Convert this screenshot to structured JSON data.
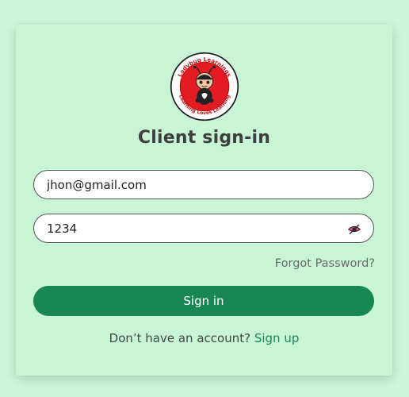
{
  "logo": {
    "top_text": "Ladybug Learnings",
    "bottom_text": "Learning Loves Learning"
  },
  "title": "Client sign-in",
  "form": {
    "email_value": "jhon@gmail.com",
    "password_value": "1234",
    "password_toggle_icon": "eye-slash-icon"
  },
  "forgot_password_label": "Forgot Password?",
  "signin_label": "Sign in",
  "signup": {
    "prompt": "Don’t have an account?",
    "link_label": "Sign up"
  },
  "colors": {
    "page_background": "#cbf7da",
    "card_background": "#c8f5d6",
    "primary": "#198754",
    "logo_red": "#e31b23"
  }
}
